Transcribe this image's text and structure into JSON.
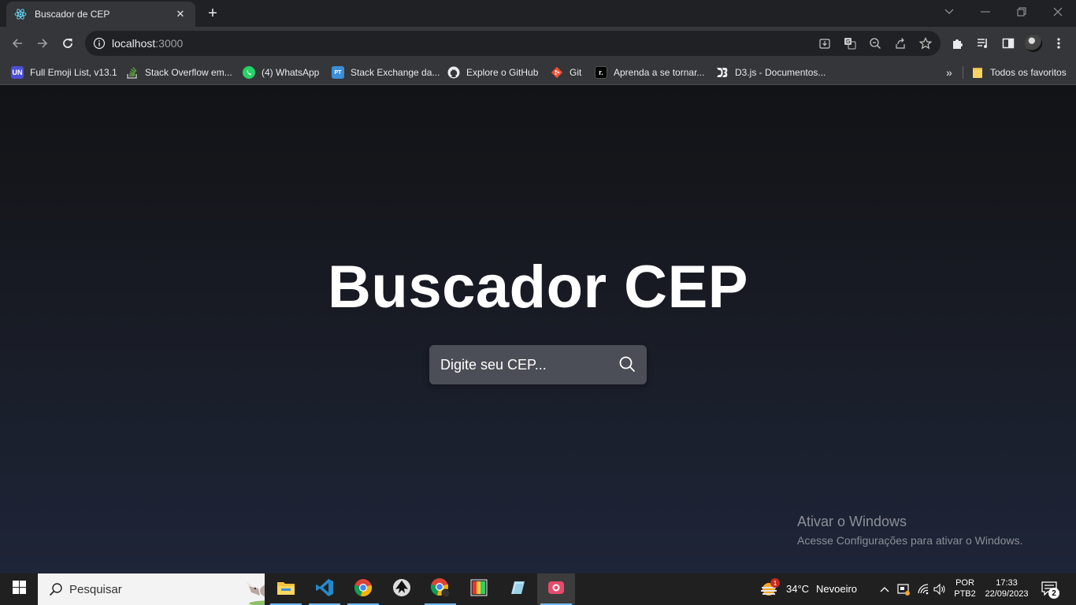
{
  "browser": {
    "tab_title": "Buscador de CEP",
    "url_host": "localhost",
    "url_port": ":3000"
  },
  "bookmarks": [
    {
      "label": "Full Emoji List, v13.1",
      "icon": "UN",
      "color": "#4c4fd6"
    },
    {
      "label": "Stack Overflow em...",
      "icon": "stackoverflow-icon",
      "color": "#5fa63b"
    },
    {
      "label": "(4) WhatsApp",
      "icon": "whatsapp-icon",
      "color": "#25d366"
    },
    {
      "label": "Stack Exchange da...",
      "icon": "PT",
      "color": "#3b8fd6"
    },
    {
      "label": "Explore o GitHub",
      "icon": "github-icon",
      "color": "#e8eaed"
    },
    {
      "label": "Git",
      "icon": "git-icon",
      "color": "#f05133"
    },
    {
      "label": "Aprenda a se tornar...",
      "icon": "r.",
      "color": "#000000"
    },
    {
      "label": "D3.js - Documentos...",
      "icon": "d3-icon",
      "color": "#222222"
    }
  ],
  "bookmarks_all": "Todos os favoritos",
  "page": {
    "title": "Buscador CEP",
    "search_placeholder": "Digite seu CEP..."
  },
  "watermark": {
    "line1": "Ativar o Windows",
    "line2": "Acesse Configurações para ativar o Windows."
  },
  "taskbar": {
    "search_label": "Pesquisar",
    "weather_temp": "34°C",
    "weather_text": "Nevoeiro",
    "weather_badge": "1",
    "lang1": "POR",
    "lang2": "PTB2",
    "time": "17:33",
    "date": "22/09/2023",
    "notifications": "2"
  },
  "colors": {
    "accent": "#6cb8f6",
    "search_box_bg": "#4b4e57"
  }
}
